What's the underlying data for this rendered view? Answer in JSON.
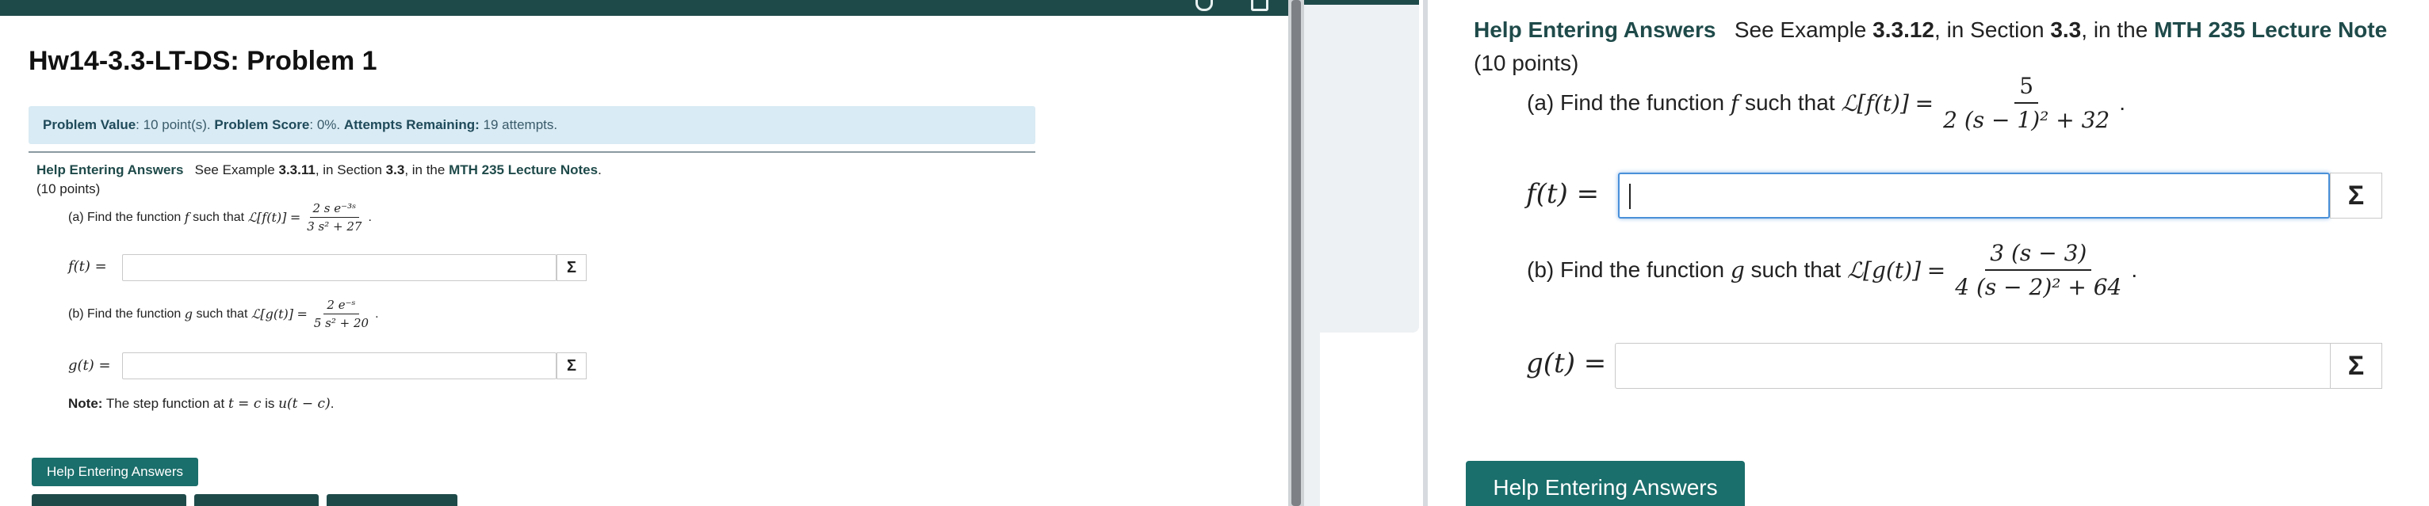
{
  "left": {
    "title": "Hw14-3.3-LT-DS: Problem 1",
    "info": {
      "value_label": "Problem Value",
      "value_text": ": 10 point(s). ",
      "score_label": "Problem Score",
      "score_text": ": 0%. ",
      "attempts_label": "Attempts Remaining:",
      "attempts_text": " 19 attempts."
    },
    "help_line": {
      "link": "Help Entering Answers",
      "see": "See Example",
      "example": "3.3.11",
      "in_section": ", in Section",
      "section": "3.3",
      "in_the": ", in the",
      "notes": "MTH 235 Lecture Notes",
      "period": "."
    },
    "points": "(10 points)",
    "part_a": {
      "prefix": "(a) Find the function",
      "var": "f",
      "such_that": "such that",
      "lhs": "ℒ[f(t)]",
      "eq": "=",
      "num": "2 s e⁻³ˢ",
      "den": "3 s² + 27",
      "end": ".",
      "answer_label": "f(t) =",
      "answer_value": ""
    },
    "part_b": {
      "prefix": "(b) Find the function",
      "var": "g",
      "such_that": "such that",
      "lhs": "ℒ[g(t)]",
      "eq": "=",
      "num": "2 e⁻ˢ",
      "den": "5 s² + 20",
      "end": ".",
      "answer_label": "g(t) =",
      "answer_value": ""
    },
    "note": {
      "label": "Note:",
      "text": "The step function at",
      "math1": "t = c",
      "is": "is",
      "math2": "u(t − c)",
      "end": "."
    },
    "help_button": "Help Entering Answers",
    "sigma": "Σ"
  },
  "right": {
    "help_line": {
      "link": "Help Entering Answers",
      "see": "See Example",
      "example": "3.3.12",
      "in_section": ", in Section",
      "section": "3.3",
      "in_the": ", in the",
      "notes": "MTH 235 Lecture Note"
    },
    "points": "(10 points)",
    "part_a": {
      "prefix": "(a) Find the function",
      "var": "f",
      "such_that": "such that",
      "lhs": "ℒ[f(t)]",
      "eq": "=",
      "num": "5",
      "den": "2 (s − 1)² + 32",
      "end": ".",
      "answer_label": "f(t) =",
      "answer_value": ""
    },
    "part_b": {
      "prefix": "(b) Find the function",
      "var": "g",
      "such_that": "such that",
      "lhs": "ℒ[g(t)]",
      "eq": "=",
      "num": "3 (s − 3)",
      "den": "4 (s − 2)² + 64",
      "end": ".",
      "answer_label": "g(t) =",
      "answer_value": ""
    },
    "help_button": "Help Entering Answers",
    "sigma": "Σ"
  },
  "colors": {
    "header": "#1f4a4a",
    "button": "#1a6e6b",
    "info_bg": "#d9ebf4",
    "focus": "#4a90d9"
  }
}
